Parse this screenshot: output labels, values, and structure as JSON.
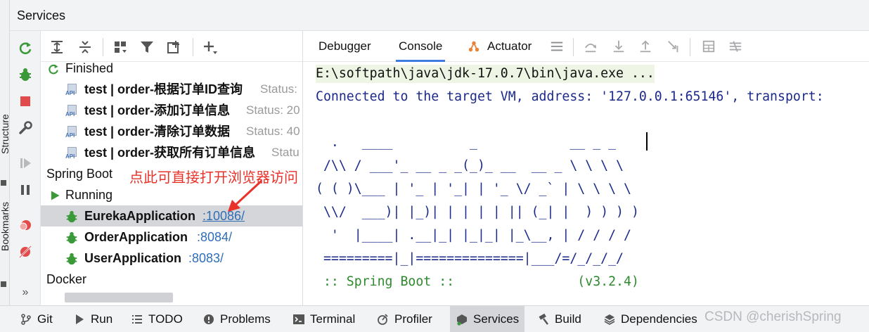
{
  "window": {
    "title": "Services"
  },
  "edge_strip": {
    "structure_label": "Structure",
    "bookmarks_label": "Bookmarks"
  },
  "tree": {
    "groups": [
      {
        "label": "Finished"
      },
      {
        "label": "Spring Boot"
      },
      {
        "label": "Running"
      },
      {
        "label": "Docker"
      }
    ],
    "finished_items": [
      {
        "name": "test | order-根据订单ID查询",
        "status": "Status:"
      },
      {
        "name": "test | order-添加订单信息",
        "status": "Status: 20"
      },
      {
        "name": "test | order-清除订单数据",
        "status": "Status: 40"
      },
      {
        "name": "test | order-获取所有订单信息",
        "status": "Statu"
      }
    ],
    "running_apps": [
      {
        "name": "EurekaApplication",
        "port": ":10086/",
        "selected": true
      },
      {
        "name": "OrderApplication",
        "port": ":8084/",
        "selected": false
      },
      {
        "name": "UserApplication",
        "port": ":8083/",
        "selected": false
      }
    ],
    "annotation": "点此可直接打开浏览器访问"
  },
  "console": {
    "tabs": [
      {
        "label": "Debugger",
        "active": false
      },
      {
        "label": "Console",
        "active": true
      },
      {
        "label": "Actuator",
        "active": false
      }
    ],
    "lines": [
      "E:\\softpath\\java\\jdk-17.0.7\\bin\\java.exe ...",
      "Connected to the target VM, address: '127.0.0.1:65146', transport:"
    ],
    "banner": [
      "  .   ____          _            __ _ _",
      " /\\\\ / ___'_ __ _ _(_)_ __  __ _ \\ \\ \\ \\",
      "( ( )\\___ | '_ | '_| | '_ \\/ _` | \\ \\ \\ \\",
      " \\\\/  ___)| |_)| | | | | || (_| |  ) ) ) )",
      "  '  |____| .__|_| |_|_| |_\\__, | / / / /",
      " =========|_|==============|___/=/_/_/_/"
    ],
    "spring_boot_label": " :: Spring Boot ::                (v3.2.4)"
  },
  "bottom_bar": {
    "items": [
      {
        "label": "Git",
        "icon": "git-branch-icon"
      },
      {
        "label": "Run",
        "icon": "play-icon"
      },
      {
        "label": "TODO",
        "icon": "list-icon"
      },
      {
        "label": "Problems",
        "icon": "warning-icon"
      },
      {
        "label": "Terminal",
        "icon": "terminal-icon"
      },
      {
        "label": "Profiler",
        "icon": "profiler-icon"
      },
      {
        "label": "Services",
        "icon": "services-icon"
      },
      {
        "label": "Build",
        "icon": "hammer-icon"
      },
      {
        "label": "Dependencies",
        "icon": "layers-icon"
      }
    ]
  },
  "watermark": "CSDN @cherishSpring",
  "colors": {
    "accent": "#3d7be0",
    "run_green": "#3a9a3a",
    "stop_red": "#e24b4b",
    "link_blue": "#2f6eb5",
    "console_blue": "#1b2a8a",
    "console_green": "#2f8a2f",
    "annotation_red": "#e8322a"
  }
}
